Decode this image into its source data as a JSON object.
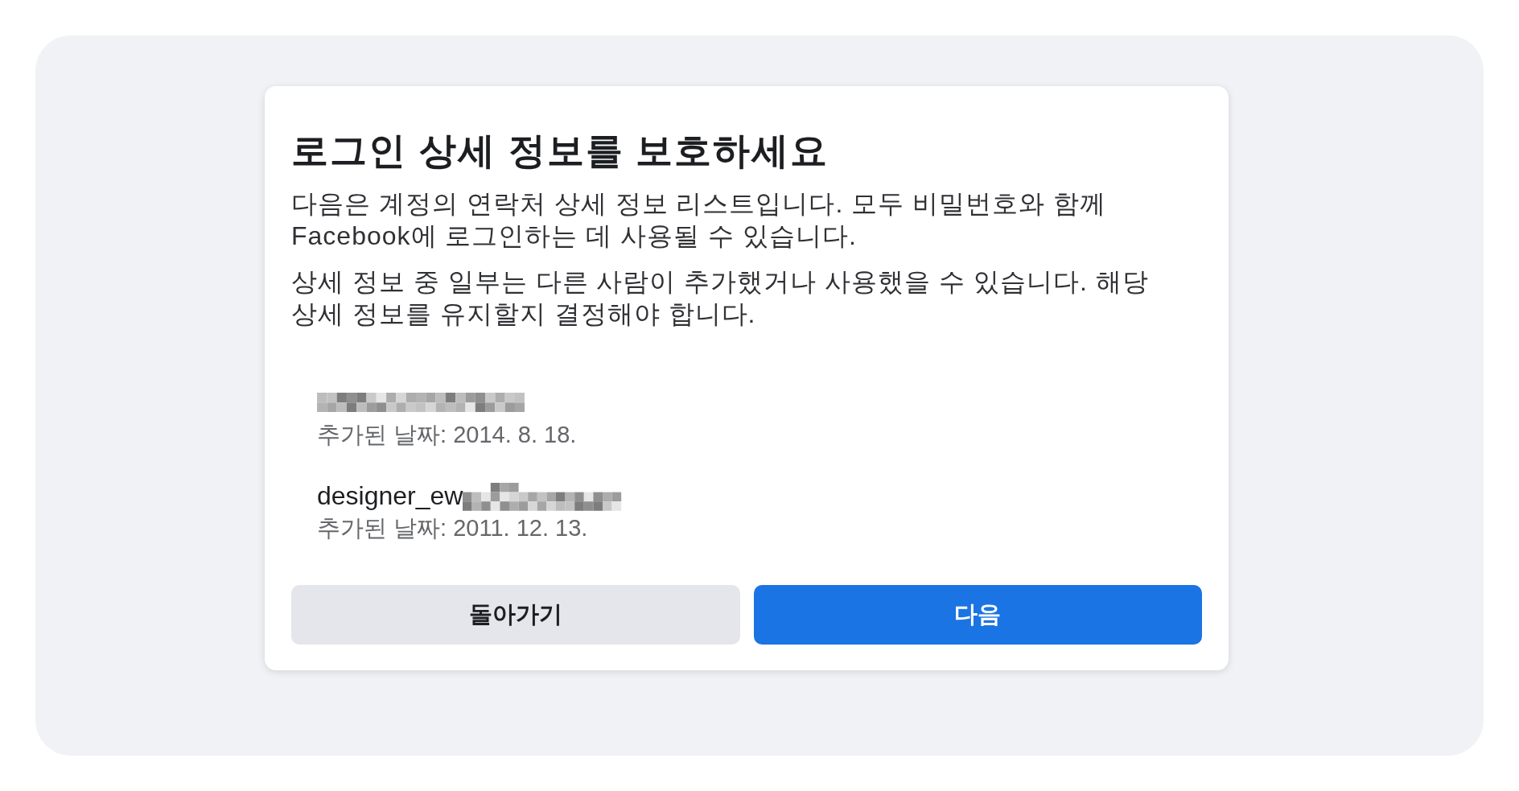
{
  "dialog": {
    "title": "로그인 상세 정보를 보호하세요",
    "paragraphs": [
      "다음은 계정의 연락처 상세 정보 리스트입니다. 모두 비밀번호와 함께 Facebook에 로그인하는 데 사용될 수 있습니다.",
      "상세 정보 중 일부는 다른 사람이 추가했거나 사용했을 수 있습니다. 해당 상세 정보를 유지할지 결정해야 합니다."
    ],
    "contacts": [
      {
        "kind": "redacted",
        "added": "추가된 날짜: 2014. 8. 18."
      },
      {
        "kind": "partial",
        "value": "designer_ew",
        "added": "추가된 날짜: 2011. 12. 13."
      }
    ],
    "buttons": [
      {
        "kind": "secondary",
        "label": "돌아가기"
      },
      {
        "kind": "primary",
        "label": "다음"
      }
    ]
  }
}
